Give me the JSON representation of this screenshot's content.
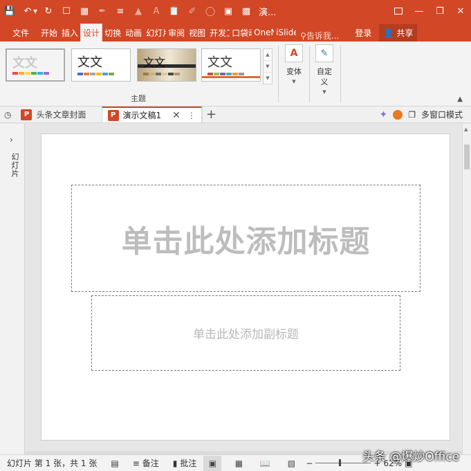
{
  "quick_access": {
    "icons": [
      "save-icon",
      "undo-icon",
      "redo-icon",
      "new-file-icon",
      "table-icon",
      "eyedropper-icon",
      "align-icon",
      "fill-icon",
      "font-color-icon",
      "paste-icon",
      "brush-icon",
      "shape-icon",
      "crop-icon",
      "color-swatch-icon"
    ],
    "window_title": "演..."
  },
  "ribbon_tabs": {
    "file": "文件",
    "items": [
      "开始",
      "插入",
      "设计",
      "切换",
      "动画",
      "幻灯片放映",
      "审阅",
      "视图",
      "开发工具",
      "口袋动画",
      "OneNote",
      "iSlide"
    ],
    "selected": "设计",
    "tell_me": "告诉我...",
    "login": "登录",
    "share": "共享"
  },
  "ribbon": {
    "themes": [
      {
        "label": "文文",
        "colors": [
          "#f04a4a",
          "#ffa92b",
          "#ffd642",
          "#55b14a",
          "#2db1e5",
          "#9b6bd1"
        ]
      },
      {
        "label": "文文",
        "colors": [
          "#4472c4",
          "#ed7d31",
          "#a5a5a5",
          "#ffc000",
          "#5b9bd5",
          "#70ad47"
        ]
      },
      {
        "label": "文文",
        "colors": [
          "#9c7b4a",
          "#c8b280",
          "#6b6b6b",
          "#e0c9a0",
          "#4a4a4a",
          "#b09870"
        ]
      },
      {
        "label": "文文",
        "colors": [
          "#c0504d",
          "#9bbb59",
          "#8064a2",
          "#4bacc6",
          "#f79646",
          "#999999"
        ]
      }
    ],
    "group_label": "主题",
    "variants_label": "变体",
    "customize_label": "自定义"
  },
  "doc_tabs": {
    "tab1": "头条文章封面",
    "tab2": "演示文稿1",
    "multi_window": "多窗口模式"
  },
  "left_pane": {
    "label": "幻灯片"
  },
  "slide": {
    "title_placeholder": "单击此处添加标题",
    "subtitle_placeholder": "单击此处添加副标题"
  },
  "status_bar": {
    "slide_info": "幻灯片 第 1 张，共 1 张",
    "notes": "备注",
    "comments": "批注",
    "zoom": "62%"
  },
  "watermark": "头条 @爆炒Office"
}
